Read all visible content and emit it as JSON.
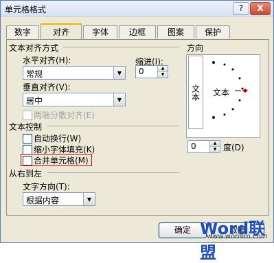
{
  "window": {
    "title": "单元格格式"
  },
  "titlebar": {
    "help": "?",
    "close": "X"
  },
  "tabs": [
    "数字",
    "对齐",
    "字体",
    "边框",
    "图案",
    "保护"
  ],
  "alignment": {
    "heading": "文本对齐方式",
    "horizontal_label": "水平对齐(H):",
    "horizontal_value": "常规",
    "indent_label": "缩进(I):",
    "indent_value": "0",
    "vertical_label": "垂直对齐(V):",
    "vertical_value": "居中",
    "distributed_label": "两端分散对齐(E)"
  },
  "control": {
    "heading": "文本控制",
    "wrap": "自动换行(W)",
    "shrink": "缩小字体填充(K)",
    "merge": "合并单元格(M)"
  },
  "rtl": {
    "heading": "从右到左",
    "direction_label": "文字方向(T):",
    "direction_value": "根据内容"
  },
  "orientation": {
    "heading": "方向",
    "vertical_text": "文本",
    "horizontal_text": "文本",
    "degree_value": "0",
    "degree_label": "度(D)"
  },
  "buttons": {
    "ok": "确定",
    "cancel": "取消"
  },
  "watermark": {
    "brand": "Word联盟",
    "url": "www.wordlm.com"
  },
  "colors": {
    "accent": "#f0b400",
    "highlight": "#e00000",
    "dial_pointer": "#c00000"
  }
}
